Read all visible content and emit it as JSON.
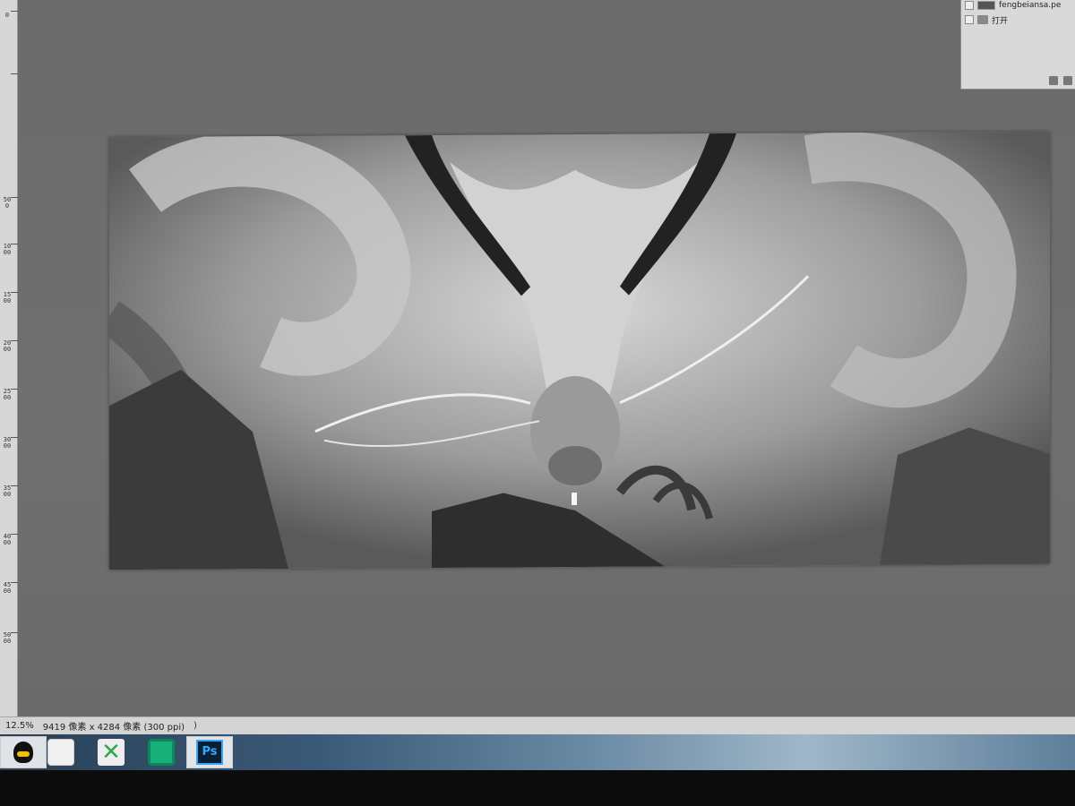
{
  "ruler": {
    "marks": [
      "0",
      "500",
      "1000",
      "1500",
      "2000",
      "2500",
      "3000",
      "3500",
      "4000",
      "4500",
      "5000"
    ]
  },
  "layers_panel": {
    "layer_name": "fengbeiansa.pe",
    "group_name": "打开"
  },
  "status_bar": {
    "zoom": "12.5%",
    "doc_info": "9419 像素 x 4284 像素 (300 ppi)",
    "arrow": ")"
  },
  "taskbar": {
    "items": [
      {
        "name": "qq",
        "icon": "qq-icon"
      },
      {
        "name": "browser",
        "icon": "browser-icon"
      },
      {
        "name": "x-app",
        "icon": "x-app-icon",
        "glyph": "✕"
      },
      {
        "name": "green-app",
        "icon": "green-app-icon"
      },
      {
        "name": "photoshop",
        "icon": "photoshop-icon",
        "glyph": "Ps"
      }
    ]
  },
  "colors": {
    "workspace": "#6b6b6b",
    "photoshop_blue": "#31a8ff",
    "ruler": "#d7d7d7"
  }
}
